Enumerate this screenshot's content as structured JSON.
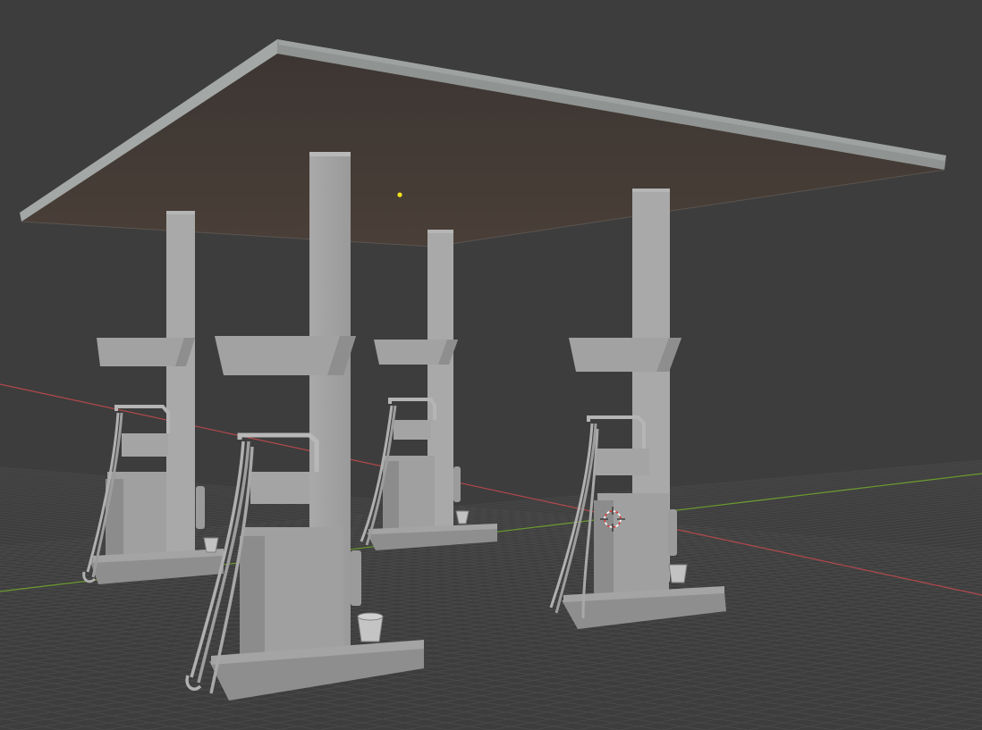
{
  "viewport": {
    "mode": "3d-viewport-solid-shading",
    "background_color": "#3d3d3d",
    "grid_color": "#4a4a4a",
    "x_axis_color": "#b3484c",
    "y_axis_color": "#6a9a2e"
  },
  "scene": {
    "objects": [
      {
        "name": "canopy-roof",
        "kind": "mesh"
      },
      {
        "name": "fuel-pump-back-left",
        "kind": "mesh"
      },
      {
        "name": "fuel-pump-front-left",
        "kind": "mesh"
      },
      {
        "name": "fuel-pump-back-center",
        "kind": "mesh"
      },
      {
        "name": "fuel-pump-front-right",
        "kind": "mesh"
      }
    ],
    "light_indicator_color": "#f4e21a",
    "cursor_icon": "3d-cursor-icon"
  }
}
